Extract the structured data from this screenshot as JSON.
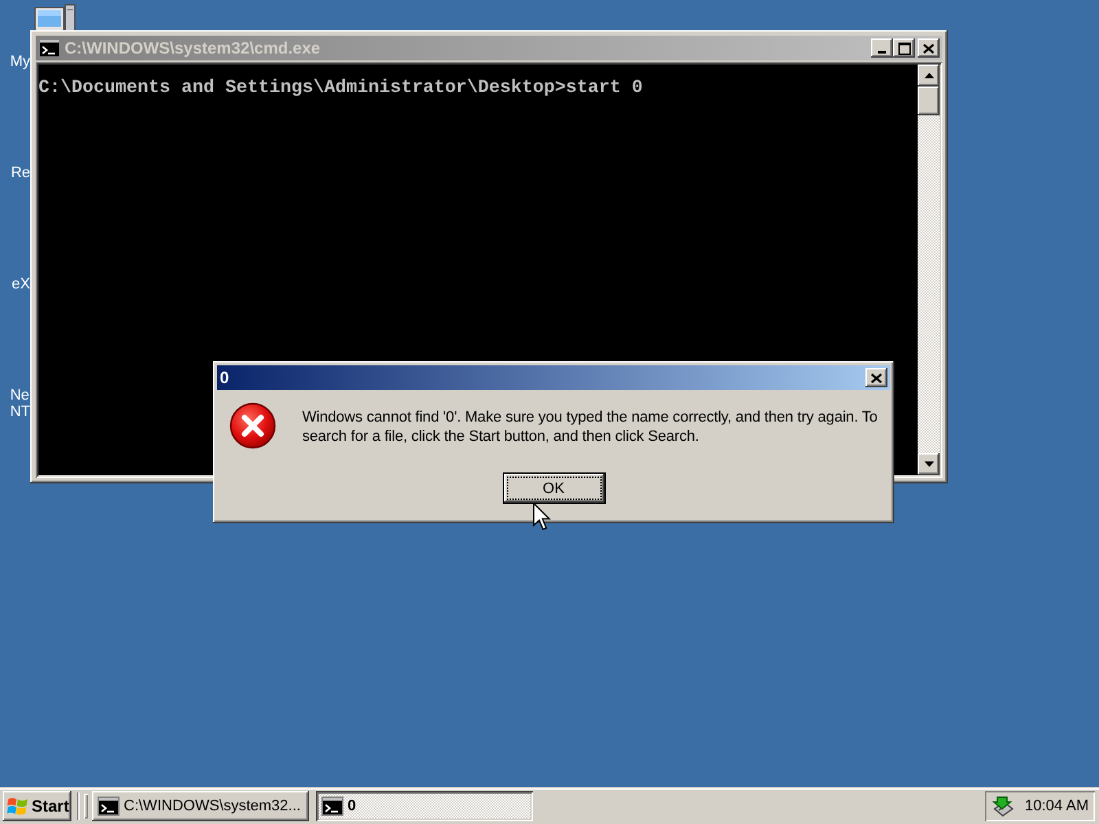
{
  "desktop": {
    "icons": [
      {
        "kind": "computer",
        "label_lines": [
          "My"
        ]
      },
      {
        "kind": "covered",
        "label_lines": [
          "Re"
        ]
      },
      {
        "kind": "covered",
        "label_lines": [
          "eX"
        ]
      },
      {
        "kind": "covered",
        "label_lines": [
          "Ne",
          "NT"
        ]
      }
    ]
  },
  "windows": [
    {
      "kind": "console",
      "title": "C:\\WINDOWS\\system32\\cmd.exe",
      "active": false,
      "lines": [
        "C:\\Documents and Settings\\Administrator\\Desktop>start 0"
      ]
    },
    {
      "kind": "message",
      "title": "0",
      "active": true,
      "message": "Windows cannot find '0'. Make sure you typed the name correctly, and then try again. To search for a file, click the Start button, and then click Search.",
      "buttons": [
        {
          "label": "OK",
          "default": true
        }
      ]
    }
  ],
  "taskbar": {
    "start_label": "Start",
    "tasks": [
      {
        "label": "C:\\WINDOWS\\system32...",
        "selected": false
      },
      {
        "label": "0",
        "selected": true
      }
    ],
    "clock": "10:04 AM"
  }
}
